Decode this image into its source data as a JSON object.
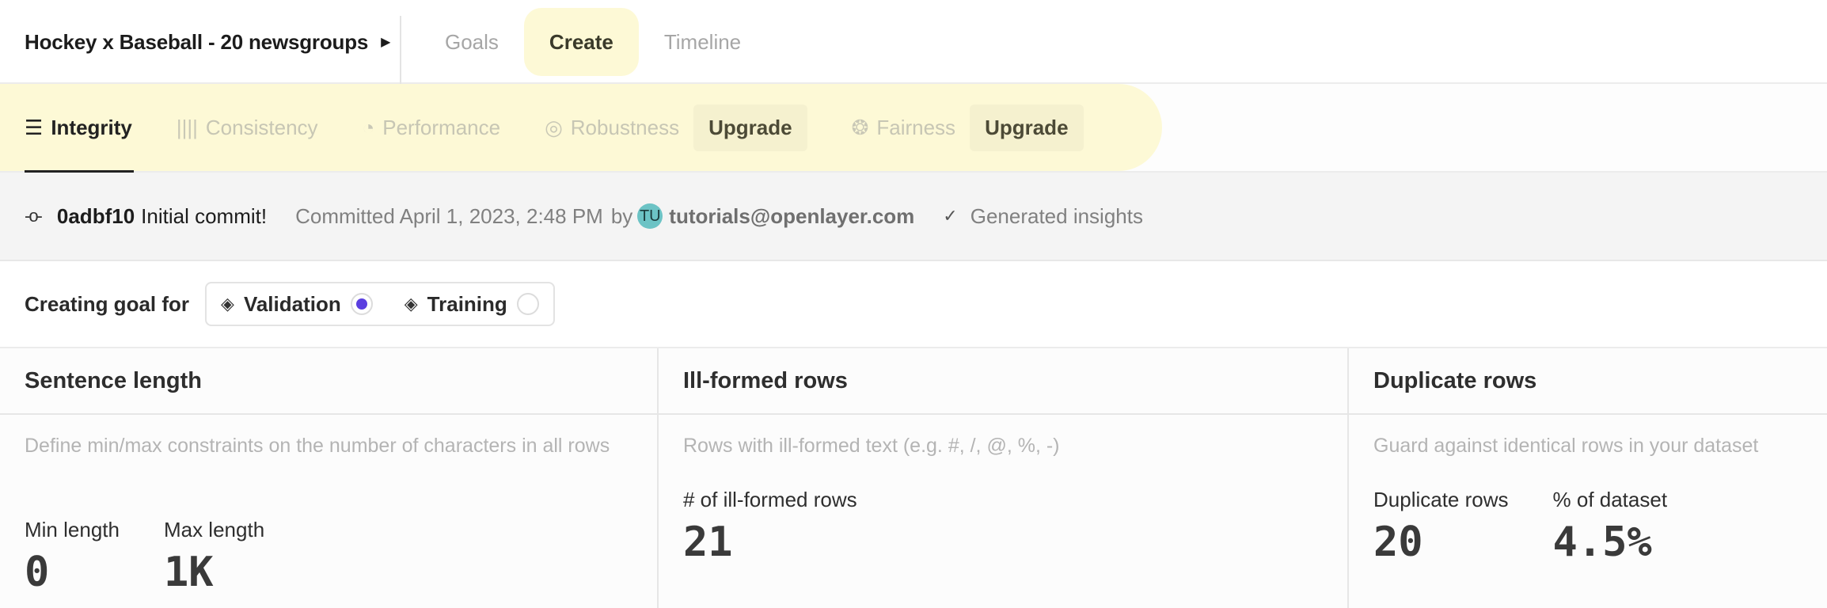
{
  "header": {
    "project_title": "Hockey x Baseball - 20 newsgroups",
    "tabs": [
      {
        "label": "Goals",
        "active": false
      },
      {
        "label": "Create",
        "active": true
      },
      {
        "label": "Timeline",
        "active": false
      }
    ]
  },
  "insight_tabs": [
    {
      "label": "Integrity",
      "icon": "list-icon",
      "active": true
    },
    {
      "label": "Consistency",
      "icon": "columns-icon",
      "active": false
    },
    {
      "label": "Performance",
      "icon": "pie-icon",
      "active": false
    },
    {
      "label": "Robustness",
      "icon": "target-icon",
      "active": false,
      "upgrade": "Upgrade"
    },
    {
      "label": "Fairness",
      "icon": "wheel-icon",
      "active": false,
      "upgrade": "Upgrade"
    }
  ],
  "commit": {
    "hash": "0adbf10",
    "message": "Initial commit!",
    "committed": "Committed April 1, 2023, 2:48 PM",
    "by": "by",
    "avatar_initials": "TU",
    "avatar_color": "#6cc3c5",
    "email": "tutorials@openlayer.com",
    "insights": "Generated insights"
  },
  "goal": {
    "label": "Creating goal for",
    "options": [
      {
        "label": "Validation",
        "selected": true
      },
      {
        "label": "Training",
        "selected": false
      }
    ],
    "accent": "#5b3fe0"
  },
  "cards": [
    {
      "title": "Sentence length",
      "description": "Define min/max constraints on the number of characters in all rows",
      "metrics": [
        {
          "label": "Min length",
          "value": "0"
        },
        {
          "label": "Max length",
          "value": "1K"
        }
      ]
    },
    {
      "title": "Ill-formed rows",
      "description": "Rows with ill-formed text (e.g. #, /, @, %, -)",
      "metrics": [
        {
          "label": "# of ill-formed rows",
          "value": "21"
        }
      ]
    },
    {
      "title": "Duplicate rows",
      "description": "Guard against identical rows in your dataset",
      "metrics": [
        {
          "label": "Duplicate rows",
          "value": "20"
        },
        {
          "label": "% of dataset",
          "value": "4.5%"
        }
      ]
    }
  ]
}
